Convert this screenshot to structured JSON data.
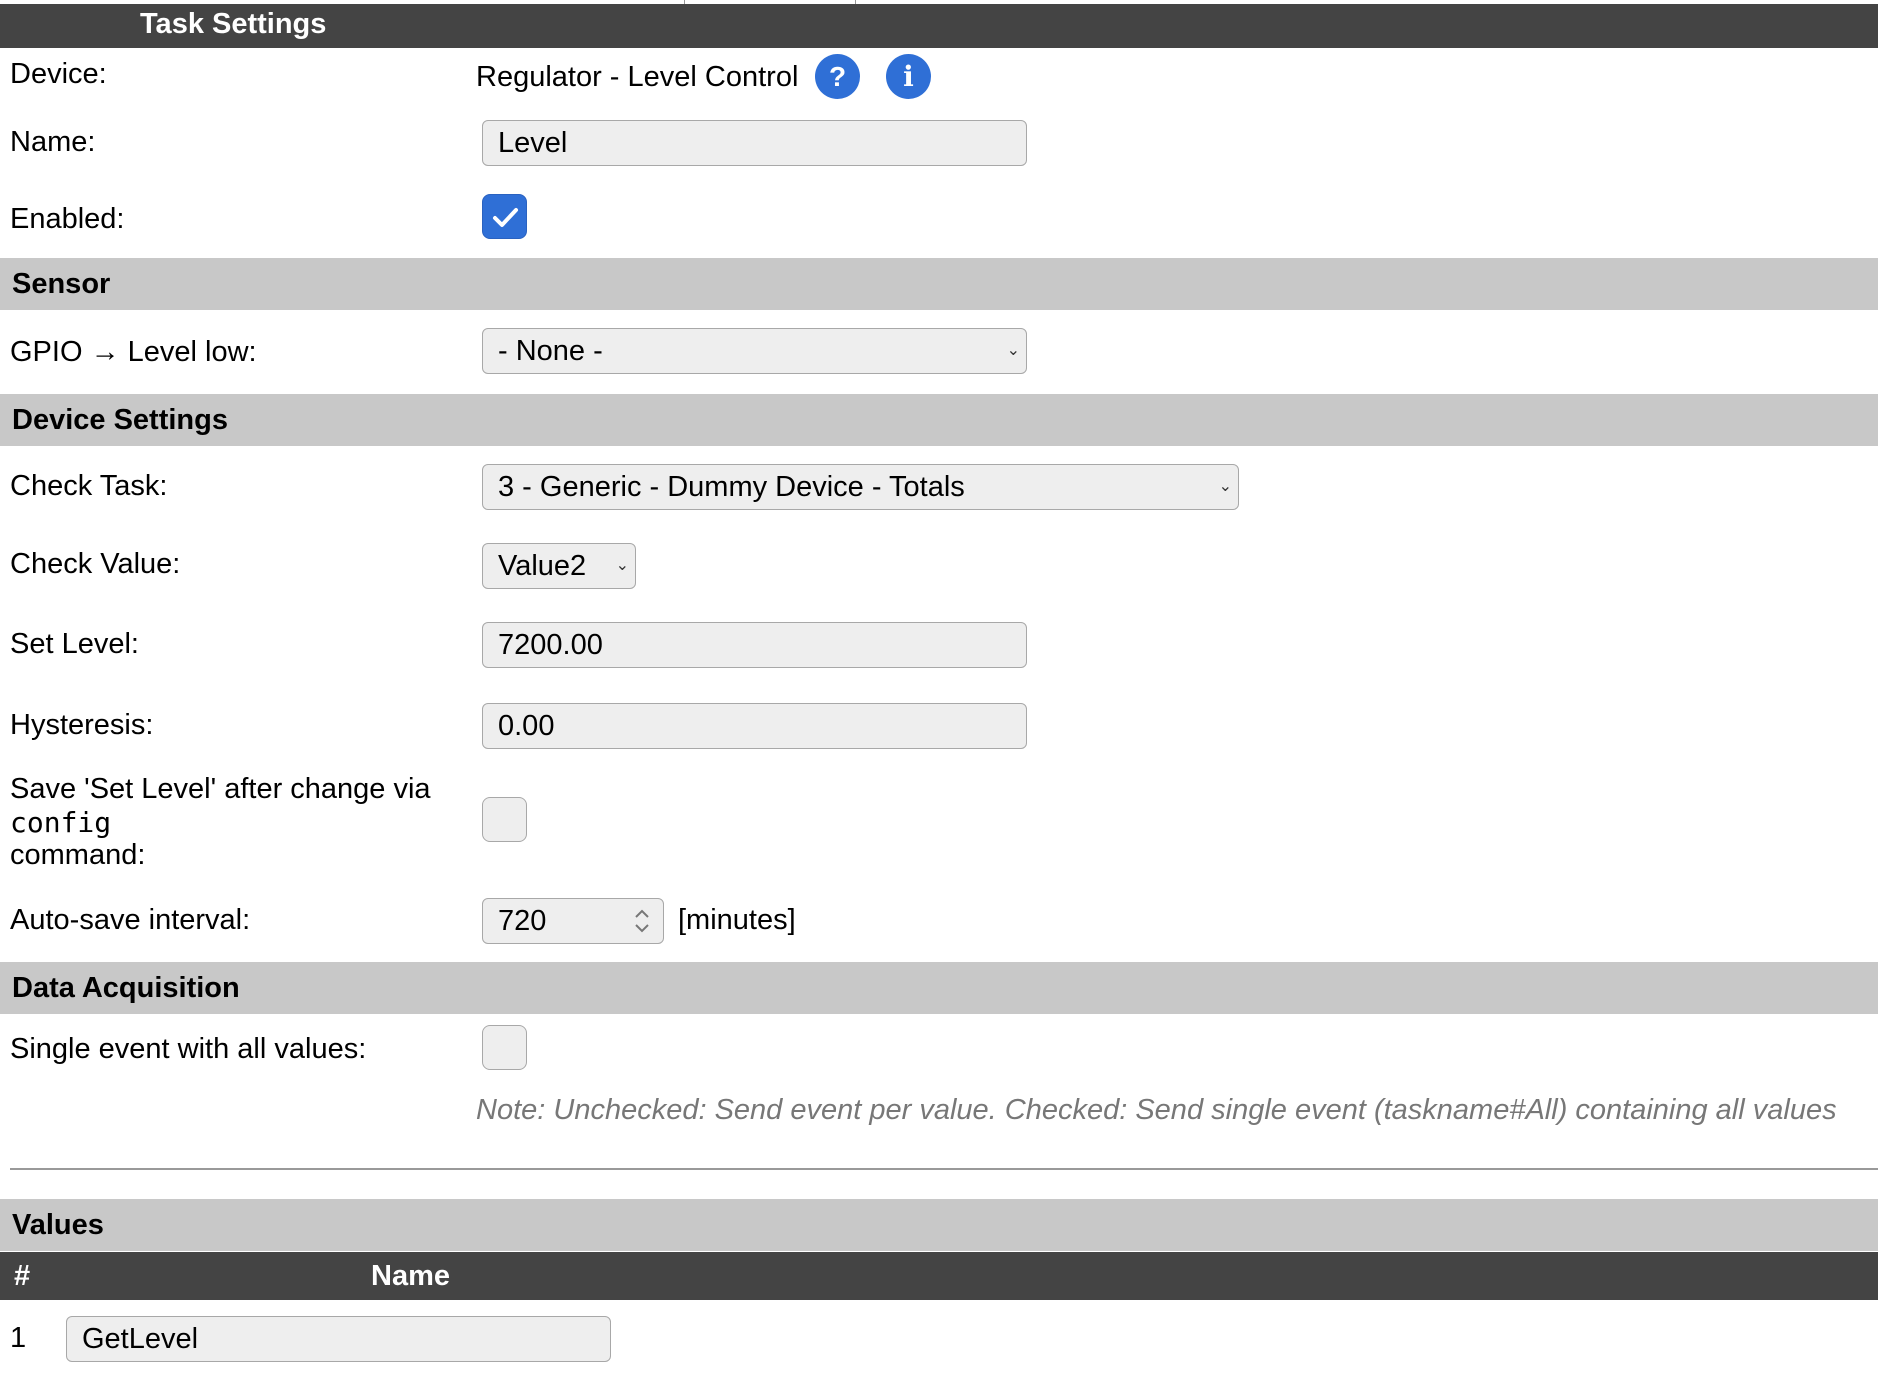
{
  "task_settings": {
    "title": "Task Settings",
    "device_label": "Device:",
    "device_value": "Regulator - Level Control",
    "help_symbol": "?",
    "info_symbol": "i",
    "name_label": "Name:",
    "name_value": "Level",
    "enabled_label": "Enabled:",
    "enabled_checked": true
  },
  "sensor": {
    "title": "Sensor",
    "gpio_label": "GPIO → Level low:",
    "gpio_value": "- None -"
  },
  "device_settings": {
    "title": "Device Settings",
    "check_task_label": "Check Task:",
    "check_task_value": "3 - Generic - Dummy Device - Totals",
    "check_value_label": "Check Value:",
    "check_value_value": "Value2",
    "set_level_label": "Set Level:",
    "set_level_value": "7200.00",
    "hysteresis_label": "Hysteresis:",
    "hysteresis_value": "0.00",
    "save_label_line1": "Save 'Set Level' after change via",
    "save_label_code": "config",
    "save_label_line3": "command:",
    "save_checked": false,
    "autosave_label": "Auto-save interval:",
    "autosave_value": "720",
    "autosave_unit": "[minutes]"
  },
  "data_acquisition": {
    "title": "Data Acquisition",
    "single_event_label": "Single event with all values:",
    "single_event_checked": false,
    "note": "Note: Unchecked: Send event per value. Checked: Send single event (taskname#All) containing all values"
  },
  "values": {
    "title": "Values",
    "col_hash": "#",
    "col_name": "Name",
    "rows": [
      {
        "index": "1",
        "name": "GetLevel"
      }
    ]
  },
  "colors": {
    "dark_header": "#444444",
    "section_header": "#c8c8c8",
    "accent_blue": "#2f6fd6",
    "input_bg": "#eeeeee",
    "note_gray": "#777777"
  }
}
